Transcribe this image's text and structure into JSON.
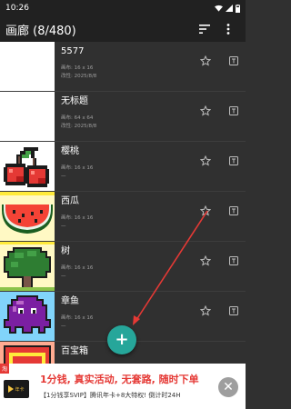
{
  "status_bar": {
    "time": "10:26"
  },
  "app_bar": {
    "title": "画廊 (8/480)"
  },
  "items": [
    {
      "name": "5577",
      "canvas": "画布: 16 x 16",
      "modified": "改性: 2025/8/8"
    },
    {
      "name": "无标题",
      "canvas": "画布: 64 x 64",
      "modified": "改性: 2025/8/8"
    },
    {
      "name": "樱桃",
      "canvas": "画布: 16 x 16",
      "modified": "—"
    },
    {
      "name": "西瓜",
      "canvas": "画布: 16 x 16",
      "modified": "—"
    },
    {
      "name": "树",
      "canvas": "画布: 16 x 16",
      "modified": "—"
    },
    {
      "name": "章鱼",
      "canvas": "画布: 16 x 16",
      "modified": "—"
    },
    {
      "name": "百宝箱",
      "canvas": "",
      "modified": ""
    }
  ],
  "fab": {
    "label": "+"
  },
  "ad": {
    "tag": "淘",
    "logo_text": "年卡",
    "headline": "1分钱, 真实活动, 无套路, 随时下单",
    "sub": "【1分钱享SVIP】腾讯年卡+8大特权! 倒计时24H",
    "close_label": "✕"
  },
  "colors": {
    "accent": "#26a69a",
    "annotation": "#e53935",
    "background": "#303030",
    "bar": "#212121"
  }
}
